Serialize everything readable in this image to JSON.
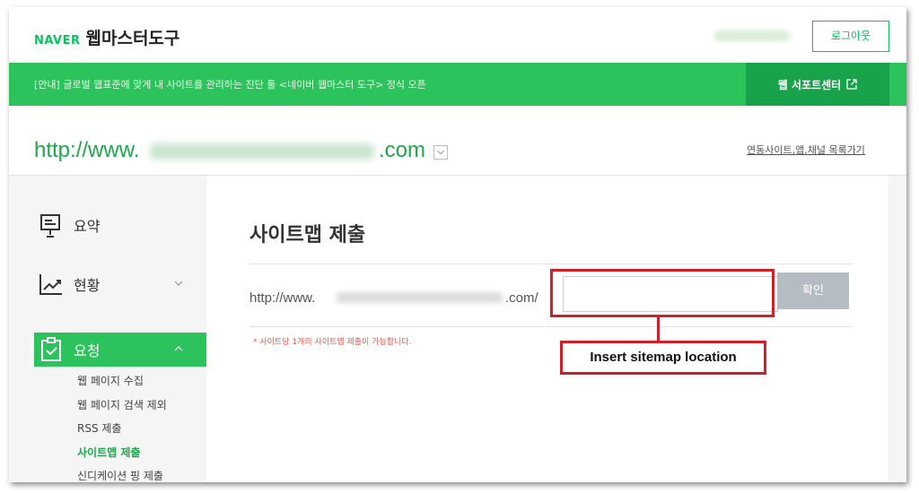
{
  "header": {
    "brand": "NAVER",
    "title": "웹마스터도구",
    "logout_label": "로그아웃"
  },
  "notice": {
    "text": "[안내] 글로벌 웹표준에 맞게 내 사이트를 관리하는 진단 툴 <네이버 웹마스터 도구> 정식 오픈",
    "support_label": "웹 서포트센터"
  },
  "site": {
    "url_prefix": "http://www.",
    "url_suffix": ".com",
    "other_sites_link": "연동사이트,앱,채널 목록가기"
  },
  "sidebar": {
    "items": [
      {
        "label": "요약",
        "icon": "presentation-icon"
      },
      {
        "label": "현황",
        "icon": "trend-chart-icon"
      },
      {
        "label": "요청",
        "icon": "clipboard-check-icon"
      }
    ],
    "sub_items": [
      {
        "label": "웹 페이지 수집",
        "active": false
      },
      {
        "label": "웹 페이지 검색 제외",
        "active": false
      },
      {
        "label": "RSS 제출",
        "active": false
      },
      {
        "label": "사이트맵 제출",
        "active": true
      },
      {
        "label": "신디케이션 핑 제출",
        "active": false
      }
    ]
  },
  "main": {
    "title": "사이트맵 제출",
    "sitemap_prefix": "http://www.",
    "sitemap_suffix": ".com/",
    "input_value": "",
    "confirm_label": "확인",
    "hint": "* 사이트당 1개의 사이트맵 제출이 가능합니다."
  },
  "annotation": {
    "label": "Insert sitemap location",
    "color": "#d11f27"
  },
  "colors": {
    "brand_green": "#03c75a",
    "notice_green": "#2dc35c",
    "support_green": "#18a24a",
    "url_green": "#1fa84b",
    "button_gray": "#b5bcc4",
    "hint_red": "#e25b4f"
  }
}
